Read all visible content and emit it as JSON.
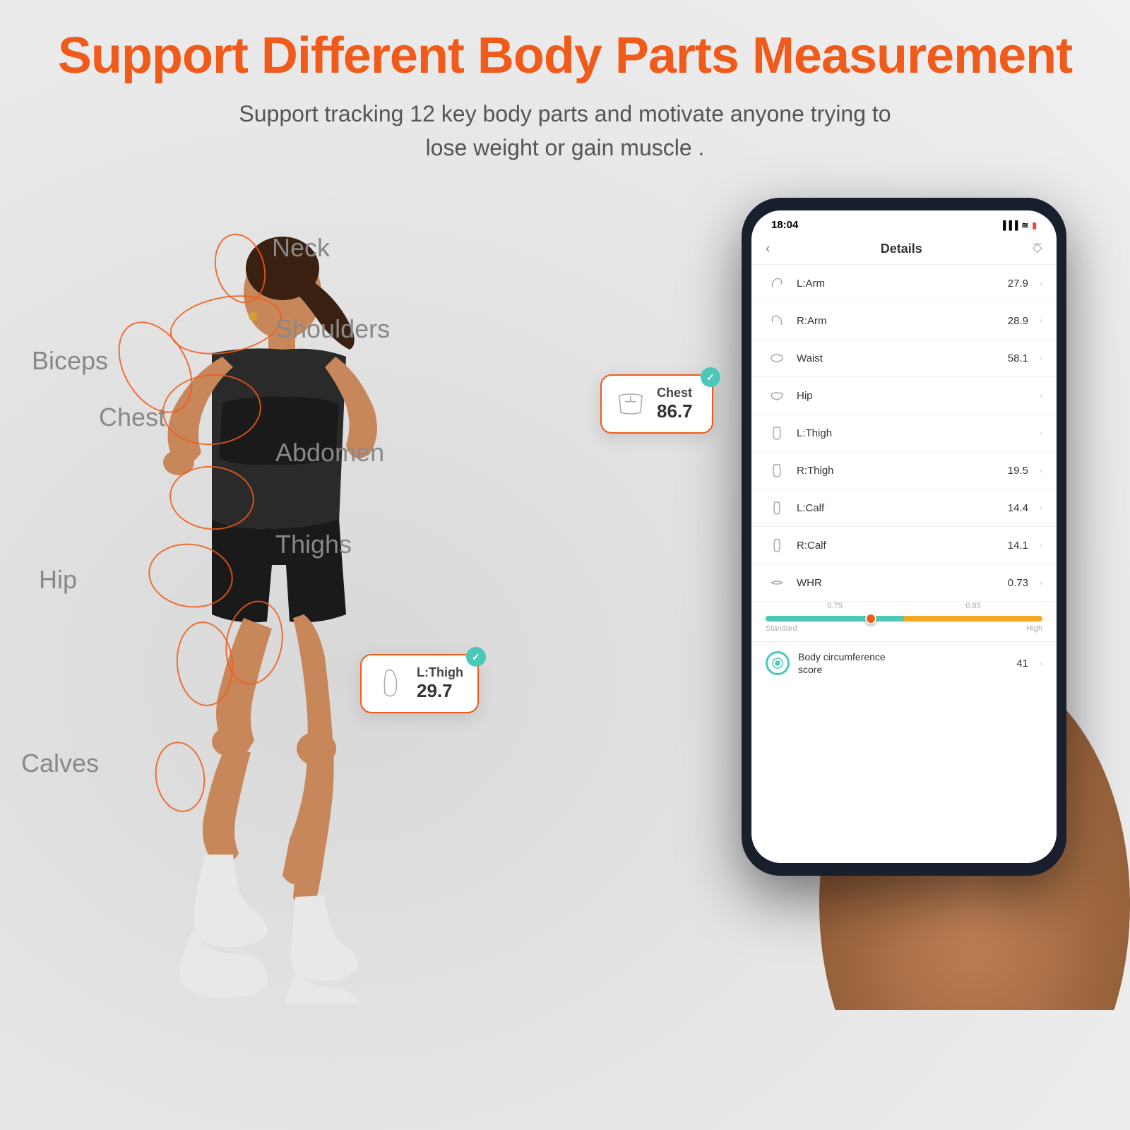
{
  "page": {
    "background_color": "#e8e8e8"
  },
  "header": {
    "title": "Support Different Body Parts Measurement",
    "subtitle_line1": "Support tracking 12 key body parts and motivate anyone trying to",
    "subtitle_line2": "lose weight or gain muscle ."
  },
  "body_labels": {
    "biceps": "Biceps",
    "neck": "Neck",
    "shoulders": "Shoulders",
    "chest": "Chest",
    "abdomen": "Abdomen",
    "hip": "Hip",
    "thighs": "Thighs",
    "calves": "Calves"
  },
  "phone": {
    "status_bar": {
      "time": "18:04",
      "icons": "▐▐▐ ≋ 🔋"
    },
    "nav": {
      "back": "‹",
      "title": "Details",
      "share": "⎏"
    },
    "measurements": [
      {
        "id": "l-arm",
        "icon": "💪",
        "name": "L:Arm",
        "value": "27.9"
      },
      {
        "id": "r-arm",
        "icon": "💪",
        "name": "R:Arm",
        "value": "28.9"
      },
      {
        "id": "waist",
        "icon": "⊙",
        "name": "Waist",
        "value": "58.1"
      },
      {
        "id": "hip",
        "icon": "⊙",
        "name": "Hip",
        "value": ""
      },
      {
        "id": "l-thigh",
        "icon": "🦵",
        "name": "L:Thigh",
        "value": ""
      },
      {
        "id": "r-thigh",
        "icon": "🦵",
        "name": "R:Thigh",
        "value": "19.5"
      },
      {
        "id": "l-calf",
        "icon": "🦵",
        "name": "L:Calf",
        "value": "14.4"
      },
      {
        "id": "r-calf",
        "icon": "🦵",
        "name": "R:Calf",
        "value": "14.1"
      },
      {
        "id": "whr",
        "icon": "⊙",
        "name": "WHR",
        "value": "0.73"
      }
    ],
    "whr_graph": {
      "values": [
        "0.75",
        "0.85"
      ],
      "labels": [
        "Standard",
        "High"
      ]
    },
    "score": {
      "label": "Body circumference\nscore",
      "value": "41"
    }
  },
  "tooltip_chest": {
    "label": "Chest",
    "value": "86.7"
  },
  "tooltip_lthigh": {
    "label": "L:Thigh",
    "value": "29.7"
  },
  "accent_color": "#f05a1a",
  "teal_color": "#4bc8b8"
}
